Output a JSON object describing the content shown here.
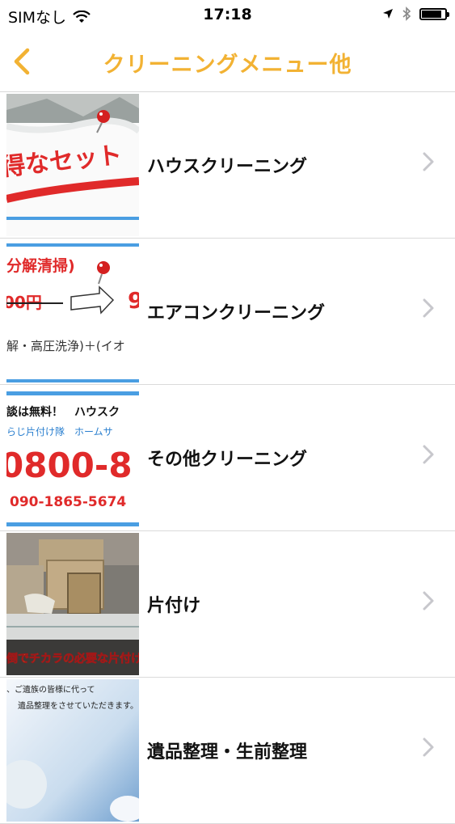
{
  "status_bar": {
    "carrier": "SIMなし",
    "time": "17:18"
  },
  "nav": {
    "title": "クリーニングメニュー他"
  },
  "menu": [
    {
      "label": "ハウスクリーニング",
      "thumb_text": "得なセット"
    },
    {
      "label": "エアコンクリーニング",
      "thumb_text": [
        "分解清掃)",
        "00円",
        "解・高圧洗浄)＋(イオ"
      ]
    },
    {
      "label": "その他クリーニング",
      "thumb_text": [
        "談は無料！　ハウスク",
        "らじ片付け隊　ホームサ",
        "0800-8",
        "090-1865-5674"
      ]
    },
    {
      "label": "片付け",
      "thumb_text": "倒でチカラの必要な片付け"
    },
    {
      "label": "遺品整理・生前整理",
      "thumb_text": [
        "、ご遺族の皆様に代って",
        "遺品整理をさせていただきます。"
      ]
    }
  ],
  "colors": {
    "accent": "#f2b233"
  }
}
